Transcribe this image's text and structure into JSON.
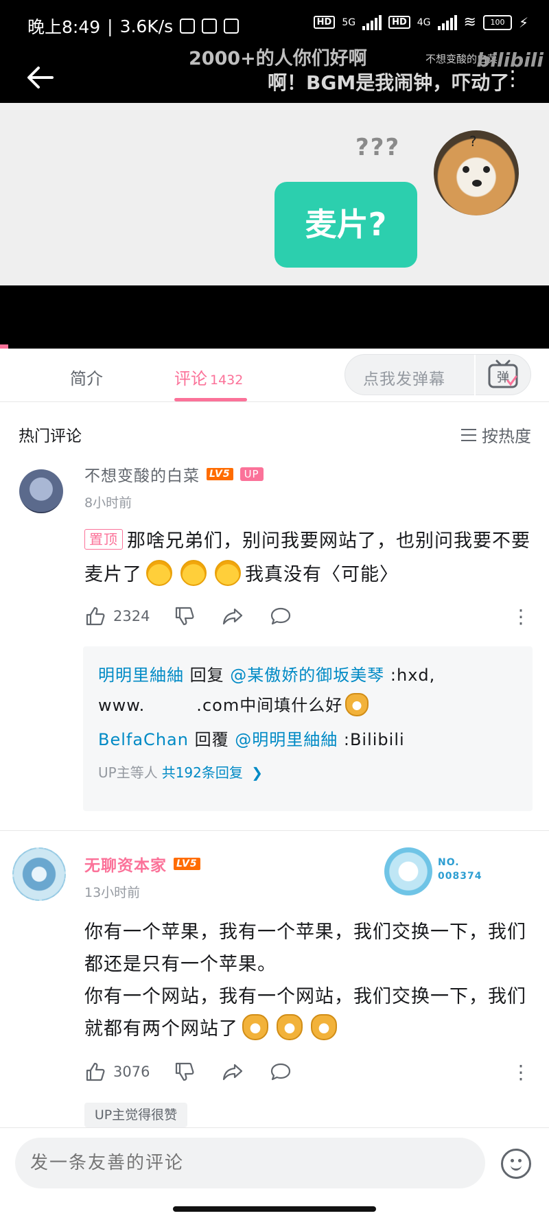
{
  "status_bar": {
    "time": "晚上8:49",
    "network_speed": "3.6K/s",
    "network_1": "5G",
    "network_2": "4G",
    "hd": "HD",
    "battery": "100"
  },
  "video": {
    "danmaku_1": "2000+的人你们好啊",
    "danmaku_2": "啊！BGM是我闹钟，吓动了",
    "watermark_user": "不想变酸的白菜",
    "watermark_logo": "bilibili",
    "frame_question": "???",
    "frame_bubble": "麦片?",
    "avatar_question": "?"
  },
  "tabs": {
    "intro": "简介",
    "comments": "评论",
    "comments_count": "1432",
    "danmaku_placeholder": "点我发弹幕",
    "danmaku_icon_label": "弹"
  },
  "list": {
    "title": "热门评论",
    "sort_label": "按热度"
  },
  "comments": [
    {
      "username": "不想变酸的白菜",
      "level": "LV5",
      "up_badge": "UP",
      "time": "8小时前",
      "pinned_label": "置顶",
      "text_part1": "那啥兄弟们，别问我要网站了，也别问我要不要麦片了",
      "text_part2": "我真没有〈可能〉",
      "likes": "2324",
      "replies": [
        {
          "user": "明明里紬紬",
          "verb": "回复",
          "target": "@某傲娇的御坂美琴",
          "text": ":hxd,",
          "text_line2": "www.　　　.com中间填什么好"
        },
        {
          "user": "BelfaChan",
          "verb": "回覆",
          "target": "@明明里紬紬",
          "text": ":Bilibili"
        }
      ],
      "reply_summary_prefix": "UP主等人",
      "reply_summary_link": "共192条回复"
    },
    {
      "username": "无聊资本家",
      "level": "LV5",
      "time": "13小时前",
      "medal_no_label": "NO.",
      "medal_no_value": "008374",
      "text_line1": "你有一个苹果，我有一个苹果，我们交换一下，我们都还是只有一个苹果。",
      "text_line2": "你有一个网站，我有一个网站，我们交换一下，我们就都有两个网站了",
      "likes": "3076",
      "up_liked_tag": "UP主觉得很赞"
    }
  ],
  "bottom": {
    "input_placeholder": "发一条友善的评论"
  },
  "colors": {
    "accent_pink": "#fb7299",
    "link_blue": "#008ac5",
    "level_orange": "#ff6c00",
    "bubble_green": "#2ccfae"
  }
}
